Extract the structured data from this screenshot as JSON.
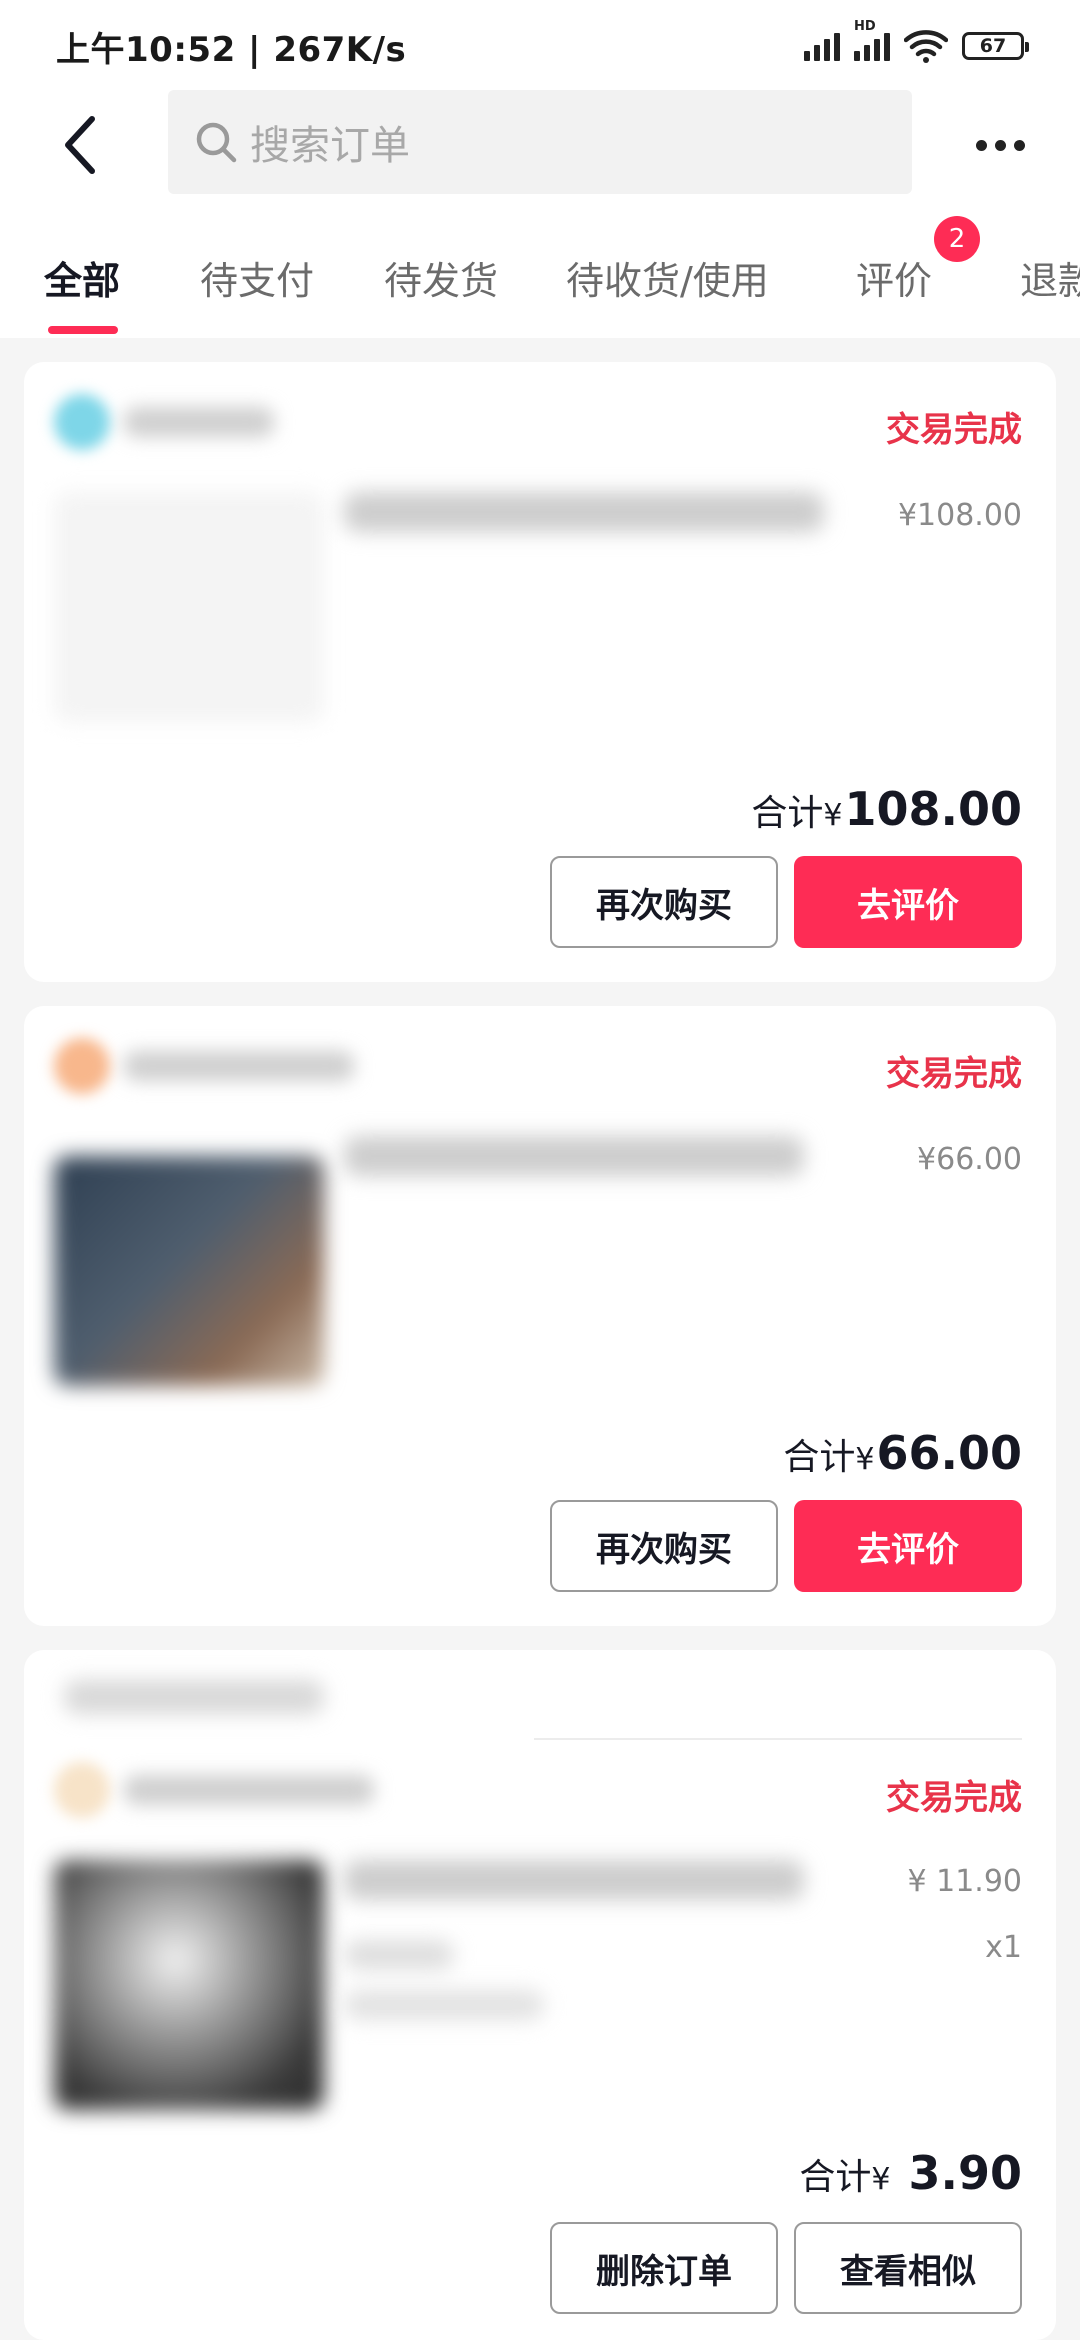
{
  "status_bar": {
    "time_speed": "上午10:52 | 267K/s",
    "hd": "HD",
    "battery": "67"
  },
  "header": {
    "search_placeholder": "搜索订单",
    "icons": [
      "back-arrow-icon",
      "search-icon",
      "more-dots-icon"
    ]
  },
  "tabs": {
    "items": [
      {
        "label": "全部",
        "active": true
      },
      {
        "label": "待支付"
      },
      {
        "label": "待发货"
      },
      {
        "label": "待收货/使用"
      },
      {
        "label": "评价",
        "badge": "2"
      },
      {
        "label": "退款"
      }
    ]
  },
  "orders": [
    {
      "status": "交易完成",
      "price": "¥108.00",
      "total_label": "合计",
      "total_currency": "¥",
      "total_amount": "108.00",
      "buttons": [
        "再次购买",
        "去评价"
      ]
    },
    {
      "status": "交易完成",
      "price": "¥66.00",
      "total_label": "合计",
      "total_currency": "¥",
      "total_amount": "66.00",
      "buttons": [
        "再次购买",
        "去评价"
      ]
    },
    {
      "status": "交易完成",
      "price": "¥ 11.90",
      "quantity": "x1",
      "total_label": "合计",
      "total_currency": "¥",
      "total_amount": " 3.90",
      "buttons": [
        "删除订单",
        "查看相似"
      ]
    }
  ],
  "colors": {
    "accent": "#fe2c55",
    "status_red": "#e8334a",
    "background": "#f5f5f5"
  }
}
